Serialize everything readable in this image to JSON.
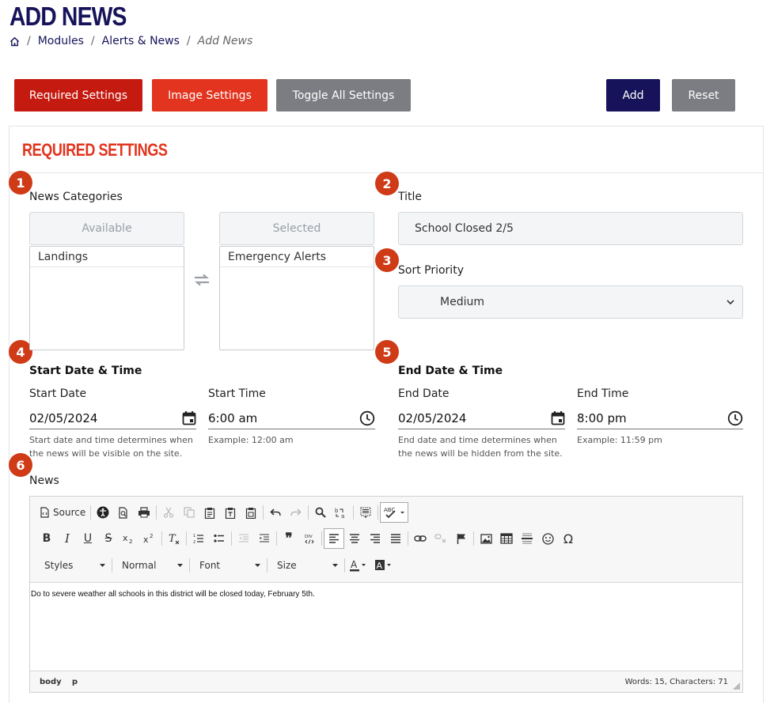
{
  "page": {
    "title": "ADD NEWS"
  },
  "breadcrumb": {
    "home_icon": "home-icon",
    "items": [
      "Modules",
      "Alerts & News"
    ],
    "current": "Add News",
    "separator": "/"
  },
  "actions": {
    "required_settings": "Required Settings",
    "image_settings": "Image Settings",
    "toggle_all": "Toggle All Settings",
    "add": "Add",
    "reset": "Reset"
  },
  "section": {
    "title": "REQUIRED SETTINGS"
  },
  "badges": [
    "1",
    "2",
    "3",
    "4",
    "5",
    "6"
  ],
  "categories": {
    "label": "News Categories",
    "available_header": "Available",
    "selected_header": "Selected",
    "available": [
      "Landings"
    ],
    "selected": [
      "Emergency Alerts"
    ]
  },
  "title_field": {
    "label": "Title",
    "value": "School Closed 2/5"
  },
  "sort_priority": {
    "label": "Sort Priority",
    "value": "Medium"
  },
  "start": {
    "heading": "Start Date & Time",
    "date_label": "Start Date",
    "date_value": "02/05/2024",
    "time_label": "Start Time",
    "time_value": "6:00 am",
    "help": "Start date and time determines when the news will be visible on the site.",
    "time_help": "Example: 12:00 am"
  },
  "end": {
    "heading": "End Date & Time",
    "date_label": "End Date",
    "date_value": "02/05/2024",
    "time_label": "End Time",
    "time_value": "8:00 pm",
    "help": "End date and time determines when the news will be hidden from the site.",
    "time_help": "Example: 11:59 pm"
  },
  "news": {
    "label": "News",
    "toolbar": {
      "source": "Source",
      "styles": "Styles",
      "format": "Normal",
      "font": "Font",
      "size": "Size",
      "spell_check": "ABC"
    },
    "content": "Do to severe weather all schools in this district will be closed today, February 5th.",
    "footer_path": [
      "body",
      "p"
    ],
    "footer_stats": "Words: 15, Characters: 71"
  },
  "colors": {
    "navy": "#16135a",
    "red": "#c41a10",
    "orange_red": "#e2341e",
    "gray": "#7b7d82",
    "badge": "#cf3a17"
  }
}
